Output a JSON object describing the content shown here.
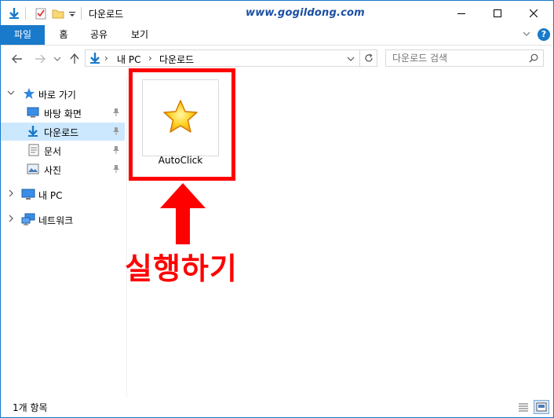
{
  "window": {
    "title": "다운로드",
    "watermark": "www.gogildong.com"
  },
  "ribbon": {
    "tabs": [
      "파일",
      "홈",
      "공유",
      "보기"
    ]
  },
  "address": {
    "crumbs": [
      "내 PC",
      "다운로드"
    ]
  },
  "search": {
    "placeholder": "다운로드 검색"
  },
  "nav": {
    "quick_access": "바로 가기",
    "items": [
      "바탕 화면",
      "다운로드",
      "문서",
      "사진"
    ],
    "this_pc": "내 PC",
    "network": "네트워크"
  },
  "files": [
    {
      "name": "AutoClick",
      "icon": "star-icon"
    }
  ],
  "annotation": {
    "label": "실행하기",
    "color": "#ff0000"
  },
  "status": {
    "count": "1개 항목"
  },
  "colors": {
    "accent": "#1979ca",
    "selected": "#cce8ff",
    "annotation": "#ff0000"
  }
}
